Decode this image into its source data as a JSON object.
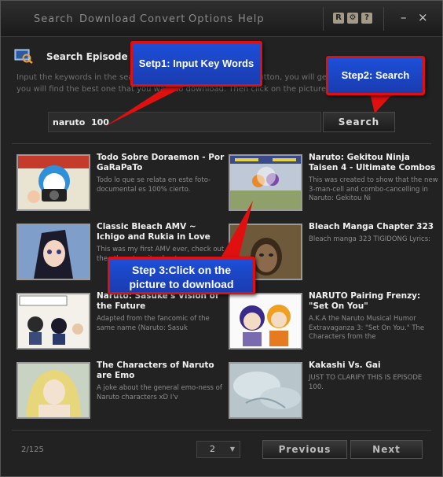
{
  "menu": {
    "items": [
      "Search",
      "Download",
      "Convert",
      "Options",
      "Help"
    ],
    "tool_buttons": [
      "R",
      "⚙",
      "?"
    ],
    "minimize": "–",
    "close": "×"
  },
  "header": {
    "title": "Search Episode",
    "instructions_line1": "Input the keywords in the search box, and click the 'Search' button, you will get a list of related videos.",
    "instructions_line2": "you will find the best one that you want to download. Then click on the picture to download it."
  },
  "search": {
    "value": "naruto  100",
    "button_label": "Search"
  },
  "results": [
    {
      "title": "Todo Sobre Doraemon - Por GaRaPaTo",
      "description": "Todo lo que se relata en este foto-documental es 100% cierto."
    },
    {
      "title": "Naruto: Gekitou Ninja Taisen 4 - Ultimate Combos",
      "description": "This was created to show that the new 3-man-cell and combo-cancelling in Naruto: Gekitou Ni"
    },
    {
      "title": "Classic Bleach AMV  ~ Ichigo and Rukia in Love",
      "description": "This was my first AMV ever, check out the others too, its about..."
    },
    {
      "title": "Bleach Manga Chapter 323",
      "description": "Bleach manga 323 TIGIDONG Lyrics:"
    },
    {
      "title": "Naruto: Sasuke's Vision of the Future",
      "description": "Adapted from the fancomic of the same name (Naruto: Sasuk"
    },
    {
      "title": "NARUTO Pairing Frenzy: \"Set On You\"",
      "description": "A.K.A the Naruto Musical Humor Extravaganza 3: \"Set On You.\" The Characters from the"
    },
    {
      "title": "The Characters of Naruto are Emo",
      "description": "A joke about the general emo-ness of Naruto characters xD I'v"
    },
    {
      "title": "Kakashi Vs. Gai",
      "description": "JUST TO CLARIFY THIS IS EPISODE 100."
    }
  ],
  "footer": {
    "page_count": "2/125",
    "page_selected": "2",
    "previous_label": "Previous",
    "next_label": "Next"
  },
  "callouts": {
    "step1": "Setp1: Input Key Words",
    "step2": "Step2: Search",
    "step3_line1": "Step 3:Click on the",
    "step3_line2": "picture to download"
  },
  "colors": {
    "background": "#222222",
    "callout_fill": "#1d4fd8",
    "callout_border": "#e01010"
  }
}
